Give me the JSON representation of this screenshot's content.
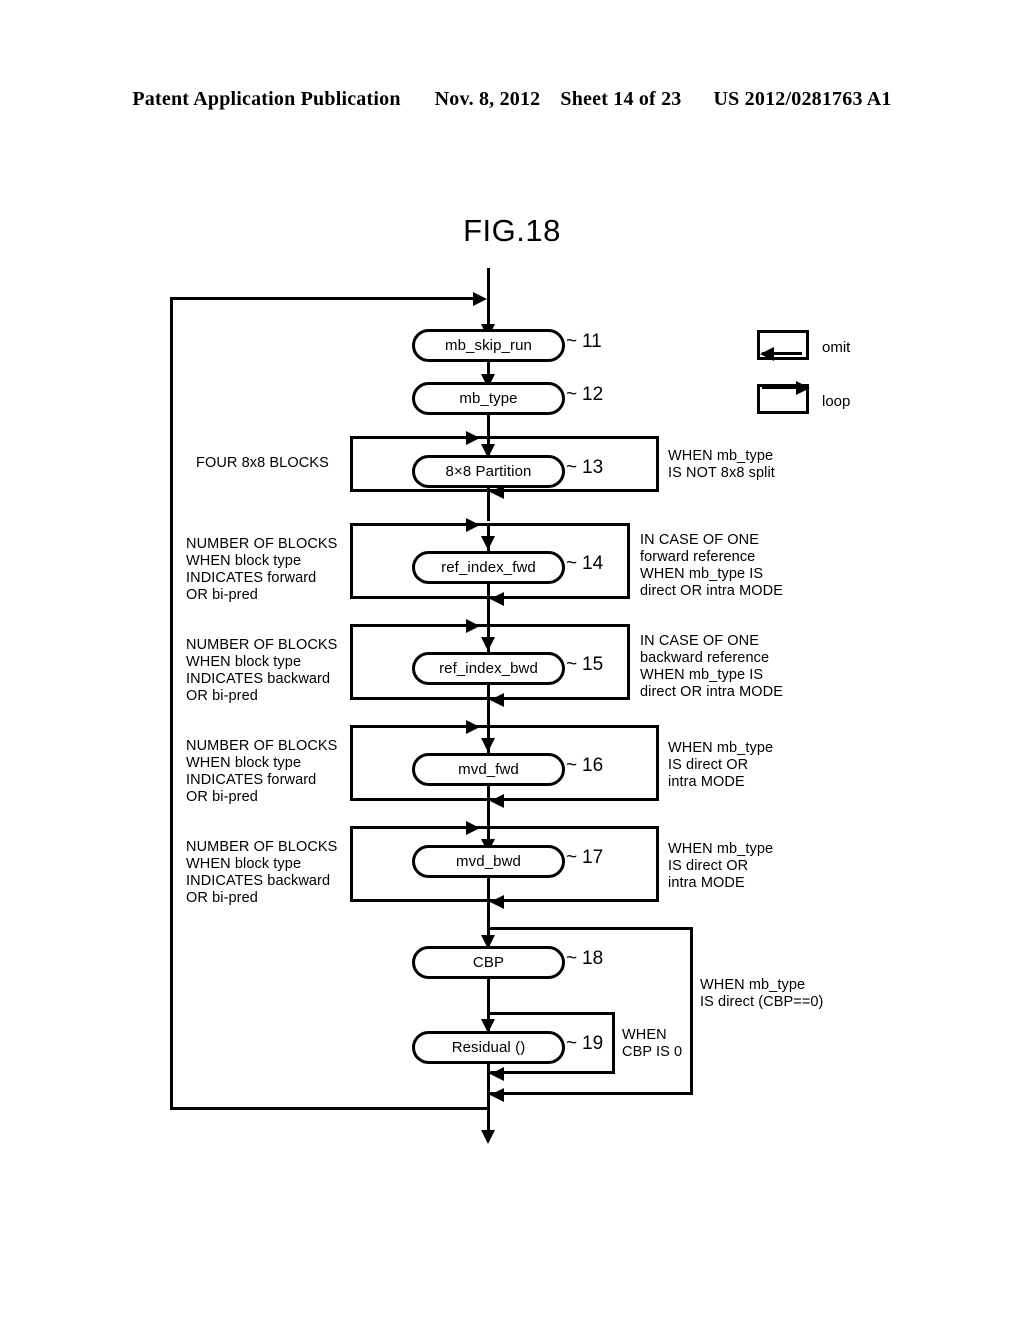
{
  "header": {
    "publication": "Patent Application Publication",
    "date": "Nov. 8, 2012",
    "sheet": "Sheet 14 of 23",
    "number": "US 2012/0281763 A1"
  },
  "figure": {
    "title": "FIG.18"
  },
  "legend": {
    "items": [
      {
        "symbol": "omit-rect-arrow-left",
        "label": "omit"
      },
      {
        "symbol": "loop-rect-arrow-right",
        "label": "loop"
      }
    ]
  },
  "flow": {
    "nodes": [
      {
        "id": "n11",
        "label": "mb_skip_run",
        "ref": "11"
      },
      {
        "id": "n12",
        "label": "mb_type",
        "ref": "12"
      },
      {
        "id": "n13",
        "label": "8×8 Partition",
        "ref": "13"
      },
      {
        "id": "n14",
        "label": "ref_index_fwd",
        "ref": "14"
      },
      {
        "id": "n15",
        "label": "ref_index_bwd",
        "ref": "15"
      },
      {
        "id": "n16",
        "label": "mvd_fwd",
        "ref": "16"
      },
      {
        "id": "n17",
        "label": "mvd_bwd",
        "ref": "17"
      },
      {
        "id": "n18",
        "label": "CBP",
        "ref": "18"
      },
      {
        "id": "n19",
        "label": "Residual ()",
        "ref": "19"
      }
    ],
    "loop_notes": [
      {
        "for": "n13",
        "text": "FOUR 8x8 BLOCKS"
      },
      {
        "for": "n14",
        "text": "NUMBER OF BLOCKS\nWHEN block type\nINDICATES forward\nOR bi-pred"
      },
      {
        "for": "n15",
        "text": "NUMBER OF BLOCKS\nWHEN block type\nINDICATES backward\nOR bi-pred"
      },
      {
        "for": "n16",
        "text": "NUMBER OF BLOCKS\nWHEN block type\nINDICATES forward\nOR bi-pred"
      },
      {
        "for": "n17",
        "text": "NUMBER OF BLOCKS\nWHEN block type\nINDICATES backward\nOR bi-pred"
      }
    ],
    "omit_notes": [
      {
        "for": "n13",
        "text": "WHEN mb_type\nIS NOT 8x8 split"
      },
      {
        "for": "n14",
        "text": "IN CASE OF ONE\nforward reference\nWHEN mb_type IS\ndirect OR intra MODE"
      },
      {
        "for": "n15",
        "text": "IN CASE OF ONE\nbackward reference\nWHEN mb_type IS\ndirect OR intra MODE"
      },
      {
        "for": "n16",
        "text": "WHEN mb_type\nIS direct OR\nintra MODE"
      },
      {
        "for": "n17",
        "text": "WHEN mb_type\nIS direct OR\nintra MODE"
      },
      {
        "for": "n18",
        "text": "WHEN mb_type\nIS direct (CBP==0)"
      },
      {
        "for": "n19",
        "text": "WHEN\nCBP IS 0"
      }
    ]
  }
}
